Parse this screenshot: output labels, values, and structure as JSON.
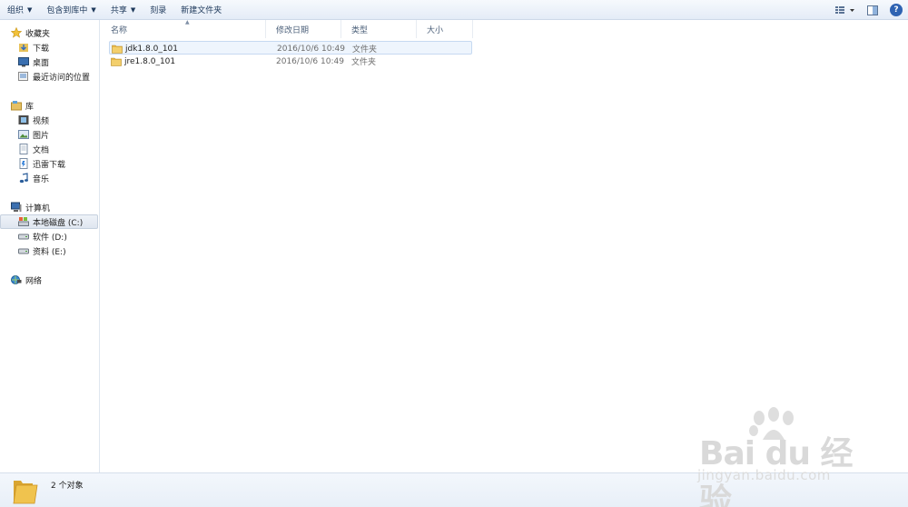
{
  "toolbar": {
    "organize": "组织",
    "include_library": "包含到库中",
    "share": "共享",
    "burn": "刻录",
    "new_folder": "新建文件夹",
    "help": "?"
  },
  "sidebar": {
    "favorites": {
      "label": "收藏夹",
      "items": [
        {
          "label": "下载",
          "icon": "download-folder-icon"
        },
        {
          "label": "桌面",
          "icon": "desktop-icon"
        },
        {
          "label": "最近访问的位置",
          "icon": "recent-places-icon"
        }
      ]
    },
    "libraries": {
      "label": "库",
      "items": [
        {
          "label": "视频",
          "icon": "video-library-icon"
        },
        {
          "label": "图片",
          "icon": "pictures-library-icon"
        },
        {
          "label": "文档",
          "icon": "documents-library-icon"
        },
        {
          "label": "迅雷下载",
          "icon": "thunder-download-icon"
        },
        {
          "label": "音乐",
          "icon": "music-library-icon"
        }
      ]
    },
    "computer": {
      "label": "计算机",
      "items": [
        {
          "label": "本地磁盘 (C:)",
          "icon": "system-drive-icon",
          "selected": true
        },
        {
          "label": "软件 (D:)",
          "icon": "drive-icon"
        },
        {
          "label": "资料 (E:)",
          "icon": "drive-icon"
        }
      ]
    },
    "network": {
      "label": "网络"
    }
  },
  "columns": {
    "name": "名称",
    "modified": "修改日期",
    "type": "类型",
    "size": "大小"
  },
  "files": [
    {
      "name": "jdk1.8.0_101",
      "modified": "2016/10/6 10:49",
      "type": "文件夹",
      "size": "",
      "selected": true
    },
    {
      "name": "jre1.8.0_101",
      "modified": "2016/10/6 10:49",
      "type": "文件夹",
      "size": "",
      "selected": false
    }
  ],
  "status": {
    "count_text": "2 个对象"
  },
  "watermark": {
    "brand": "Bai du 经验",
    "url": "jingyan.baidu.com"
  },
  "colors": {
    "accent": "#2e63b2",
    "folder": "#e8b84a",
    "toolbar_text": "#1e395b",
    "selection_bg": "#eef5fd"
  }
}
